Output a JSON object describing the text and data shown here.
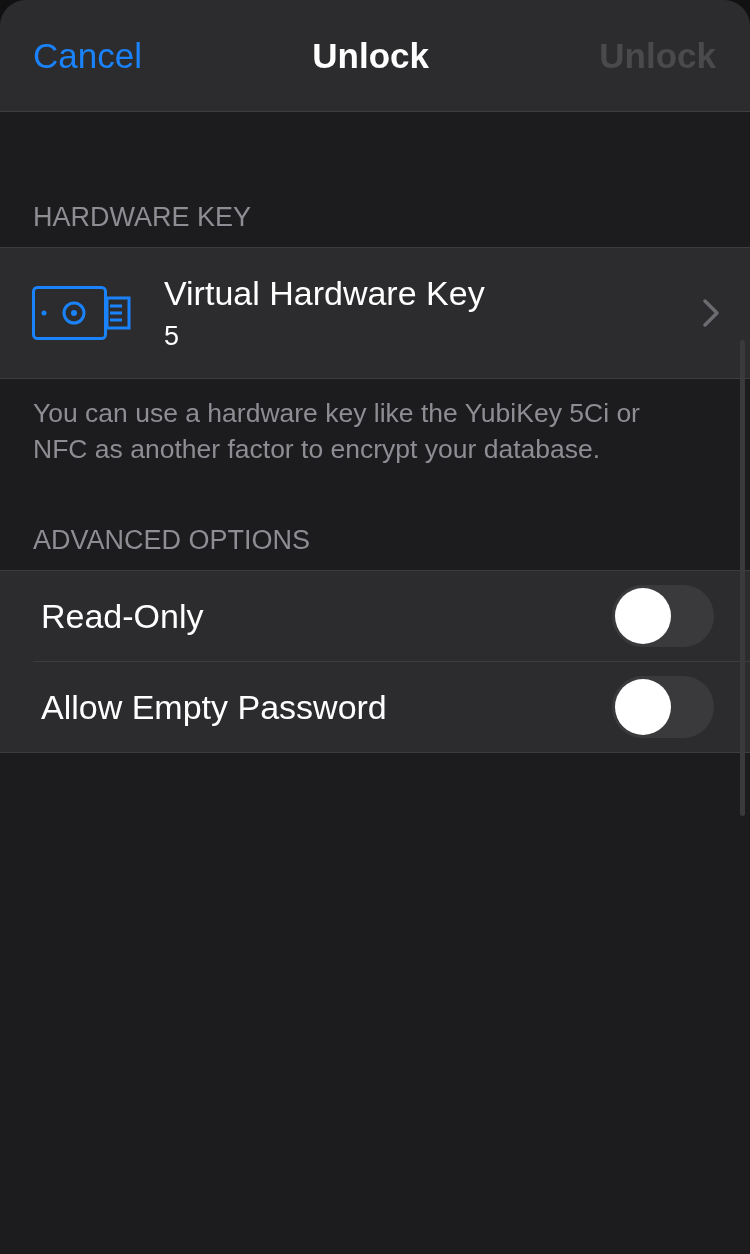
{
  "nav": {
    "cancel": "Cancel",
    "title": "Unlock",
    "action": "Unlock",
    "action_disabled": true
  },
  "hardware_section": {
    "header": "HARDWARE KEY",
    "key": {
      "title": "Virtual Hardware Key",
      "subtitle": "5"
    },
    "footer": "You can use a hardware key like the YubiKey 5Ci or NFC as another factor to encrypt your database."
  },
  "advanced_section": {
    "header": "ADVANCED OPTIONS",
    "options": [
      {
        "label": "Read-Only",
        "on": false
      },
      {
        "label": "Allow Empty Password",
        "on": false
      }
    ]
  }
}
